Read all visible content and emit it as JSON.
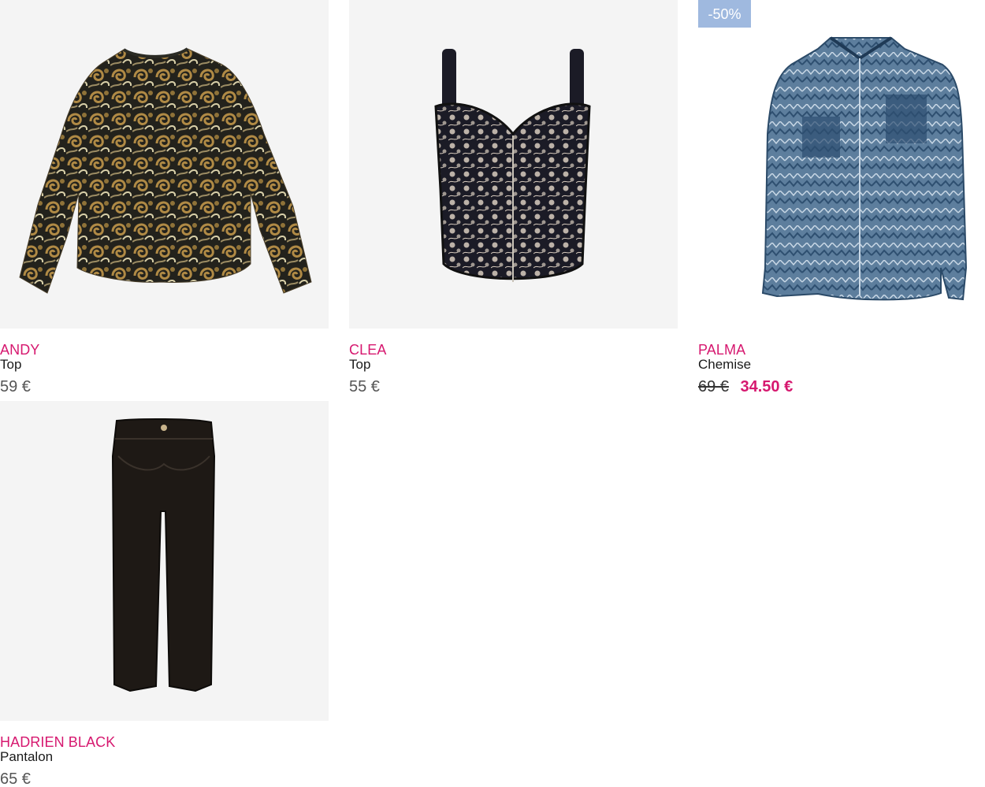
{
  "products": [
    {
      "brand": "ANDY",
      "type": "Top",
      "price": "59 €",
      "image_icon": "paisley-blouse-image",
      "colors": {
        "primary": "#8a7442",
        "secondary": "#1f1d16"
      }
    },
    {
      "brand": "CLEA",
      "type": "Top",
      "price": "55 €",
      "image_icon": "lace-bustier-image",
      "colors": {
        "primary": "#1b1b26",
        "secondary": "#d9cdbf"
      }
    },
    {
      "brand": "PALMA",
      "type": "Chemise",
      "old_price": "69 €",
      "sale_price": "34.50 €",
      "badge": "-50%",
      "image_icon": "blue-print-shirt-image",
      "colors": {
        "primary": "#3d6284",
        "secondary": "#c9d8e6"
      }
    },
    {
      "brand": "HADRIEN BLACK",
      "type": "Pantalon",
      "price": "65 €",
      "image_icon": "black-trousers-image",
      "colors": {
        "primary": "#1e1915"
      }
    }
  ],
  "colors": {
    "brand": "#d6186f",
    "badge_bg": "#9fb9df",
    "card_bg": "#f4f4f4",
    "price_text": "#555555"
  }
}
